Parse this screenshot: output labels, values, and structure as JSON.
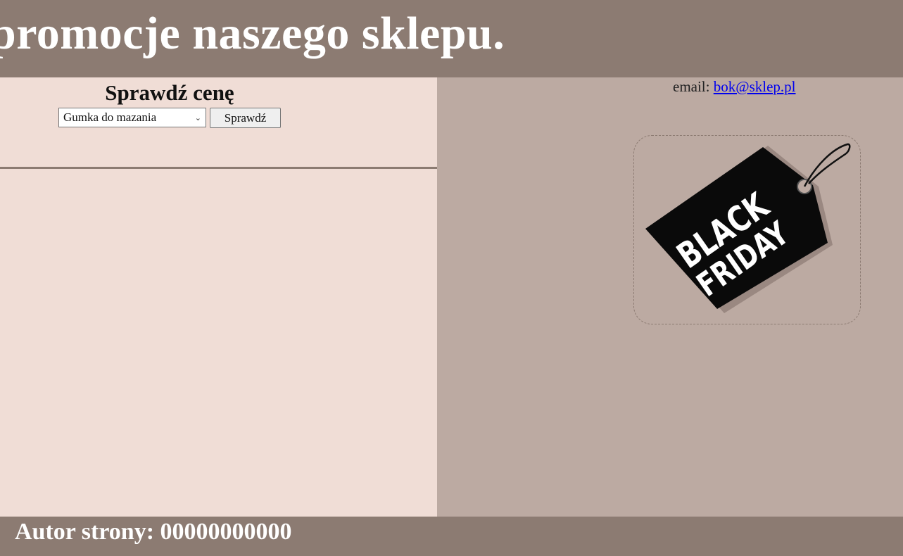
{
  "header": {
    "title": "promocje naszego sklepu."
  },
  "left": {
    "heading": "Sprawdź cenę",
    "select": {
      "selected": "Gumka do mazania"
    },
    "button_label": "Sprawdź"
  },
  "right": {
    "email_label": "email: ",
    "email_link": "bok@sklep.pl",
    "promo_image": {
      "line1": "BLACK",
      "line2": "FRIDAY"
    }
  },
  "footer": {
    "text": "Autor strony: 00000000000"
  },
  "colors": {
    "header_bg": "#8c7b72",
    "left_bg": "#f0ddd6",
    "right_bg": "#bcaaa2",
    "link": "#0000ee"
  }
}
